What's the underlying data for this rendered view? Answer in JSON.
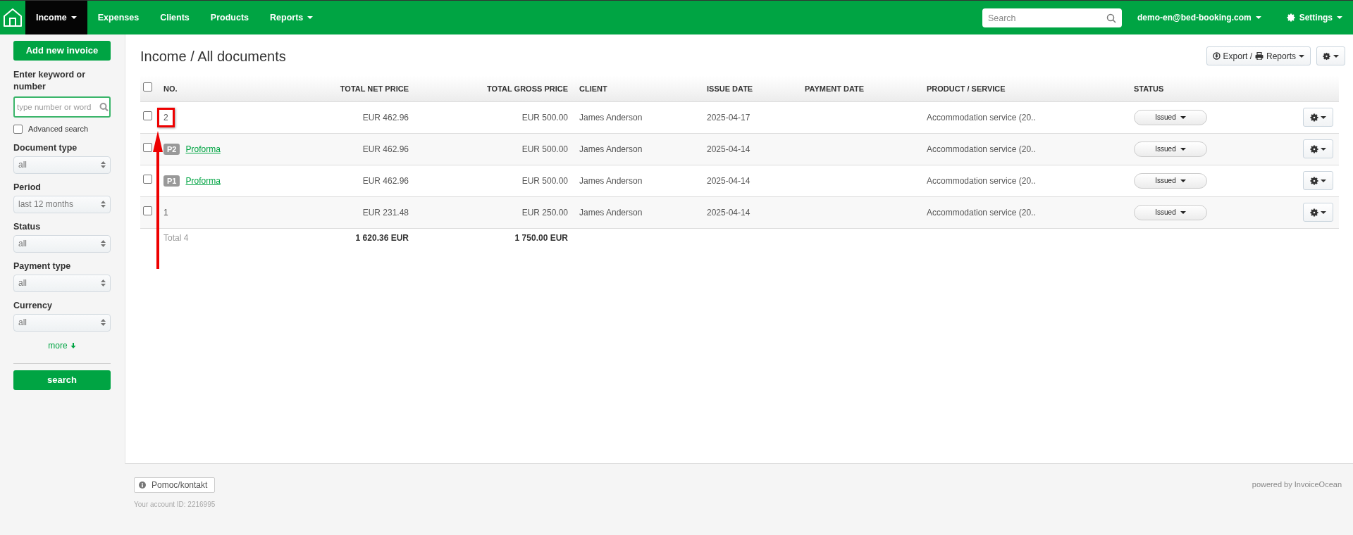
{
  "nav": {
    "items": [
      {
        "label": "Income",
        "selected": true,
        "dropdown": true
      },
      {
        "label": "Expenses",
        "selected": false,
        "dropdown": false
      },
      {
        "label": "Clients",
        "selected": false,
        "dropdown": false
      },
      {
        "label": "Products",
        "selected": false,
        "dropdown": false
      },
      {
        "label": "Reports",
        "selected": false,
        "dropdown": true
      }
    ],
    "search_placeholder": "Search",
    "user": "demo-en@bed-booking.com",
    "settings": "Settings"
  },
  "sidebar": {
    "add_button": "Add new invoice",
    "keyword_label": "Enter keyword or number",
    "keyword_placeholder": "type number or word",
    "advanced": {
      "label": "Advanced search",
      "checked": false
    },
    "filters": [
      {
        "label": "Document type",
        "value": "all"
      },
      {
        "label": "Period",
        "value": "last 12 months"
      },
      {
        "label": "Status",
        "value": "all"
      },
      {
        "label": "Payment type",
        "value": "all"
      },
      {
        "label": "Currency",
        "value": "all"
      }
    ],
    "more": "more",
    "search_button": "search"
  },
  "page_title": "Income / All documents",
  "toolbar": {
    "export": "Export /",
    "reports": "Reports"
  },
  "table": {
    "select_all_checked": false,
    "columns": [
      "NO.",
      "TOTAL NET PRICE",
      "TOTAL GROSS PRICE",
      "CLIENT",
      "ISSUE DATE",
      "PAYMENT DATE",
      "PRODUCT / SERVICE",
      "STATUS"
    ],
    "rows": [
      {
        "checked": false,
        "highlighted": true,
        "number": "2",
        "net": "EUR 462.96",
        "gross": "EUR 500.00",
        "client": "James Anderson",
        "issue_date": "2025-04-17",
        "product": "Accommodation service (20..",
        "status": "Issued"
      },
      {
        "checked": false,
        "highlighted": false,
        "badge": "P2",
        "link": "Proforma",
        "net": "EUR 462.96",
        "gross": "EUR 500.00",
        "client": "James Anderson",
        "issue_date": "2025-04-14",
        "product": "Accommodation service (20..",
        "status": "Issued"
      },
      {
        "checked": false,
        "highlighted": false,
        "badge": "P1",
        "link": "Proforma",
        "net": "EUR 462.96",
        "gross": "EUR 500.00",
        "client": "James Anderson",
        "issue_date": "2025-04-14",
        "product": "Accommodation service (20..",
        "status": "Issued"
      },
      {
        "checked": false,
        "highlighted": false,
        "number": "1",
        "net": "EUR 231.48",
        "gross": "EUR 250.00",
        "client": "James Anderson",
        "issue_date": "2025-04-14",
        "product": "Accommodation service (20..",
        "status": "Issued"
      }
    ],
    "total": {
      "label": "Total 4",
      "net": "1 620.36 EUR",
      "gross": "1 750.00 EUR"
    }
  },
  "footer": {
    "help": "Pomoc/kontakt",
    "account": "Your account ID: 2216995",
    "powered": "powered by InvoiceOcean"
  }
}
